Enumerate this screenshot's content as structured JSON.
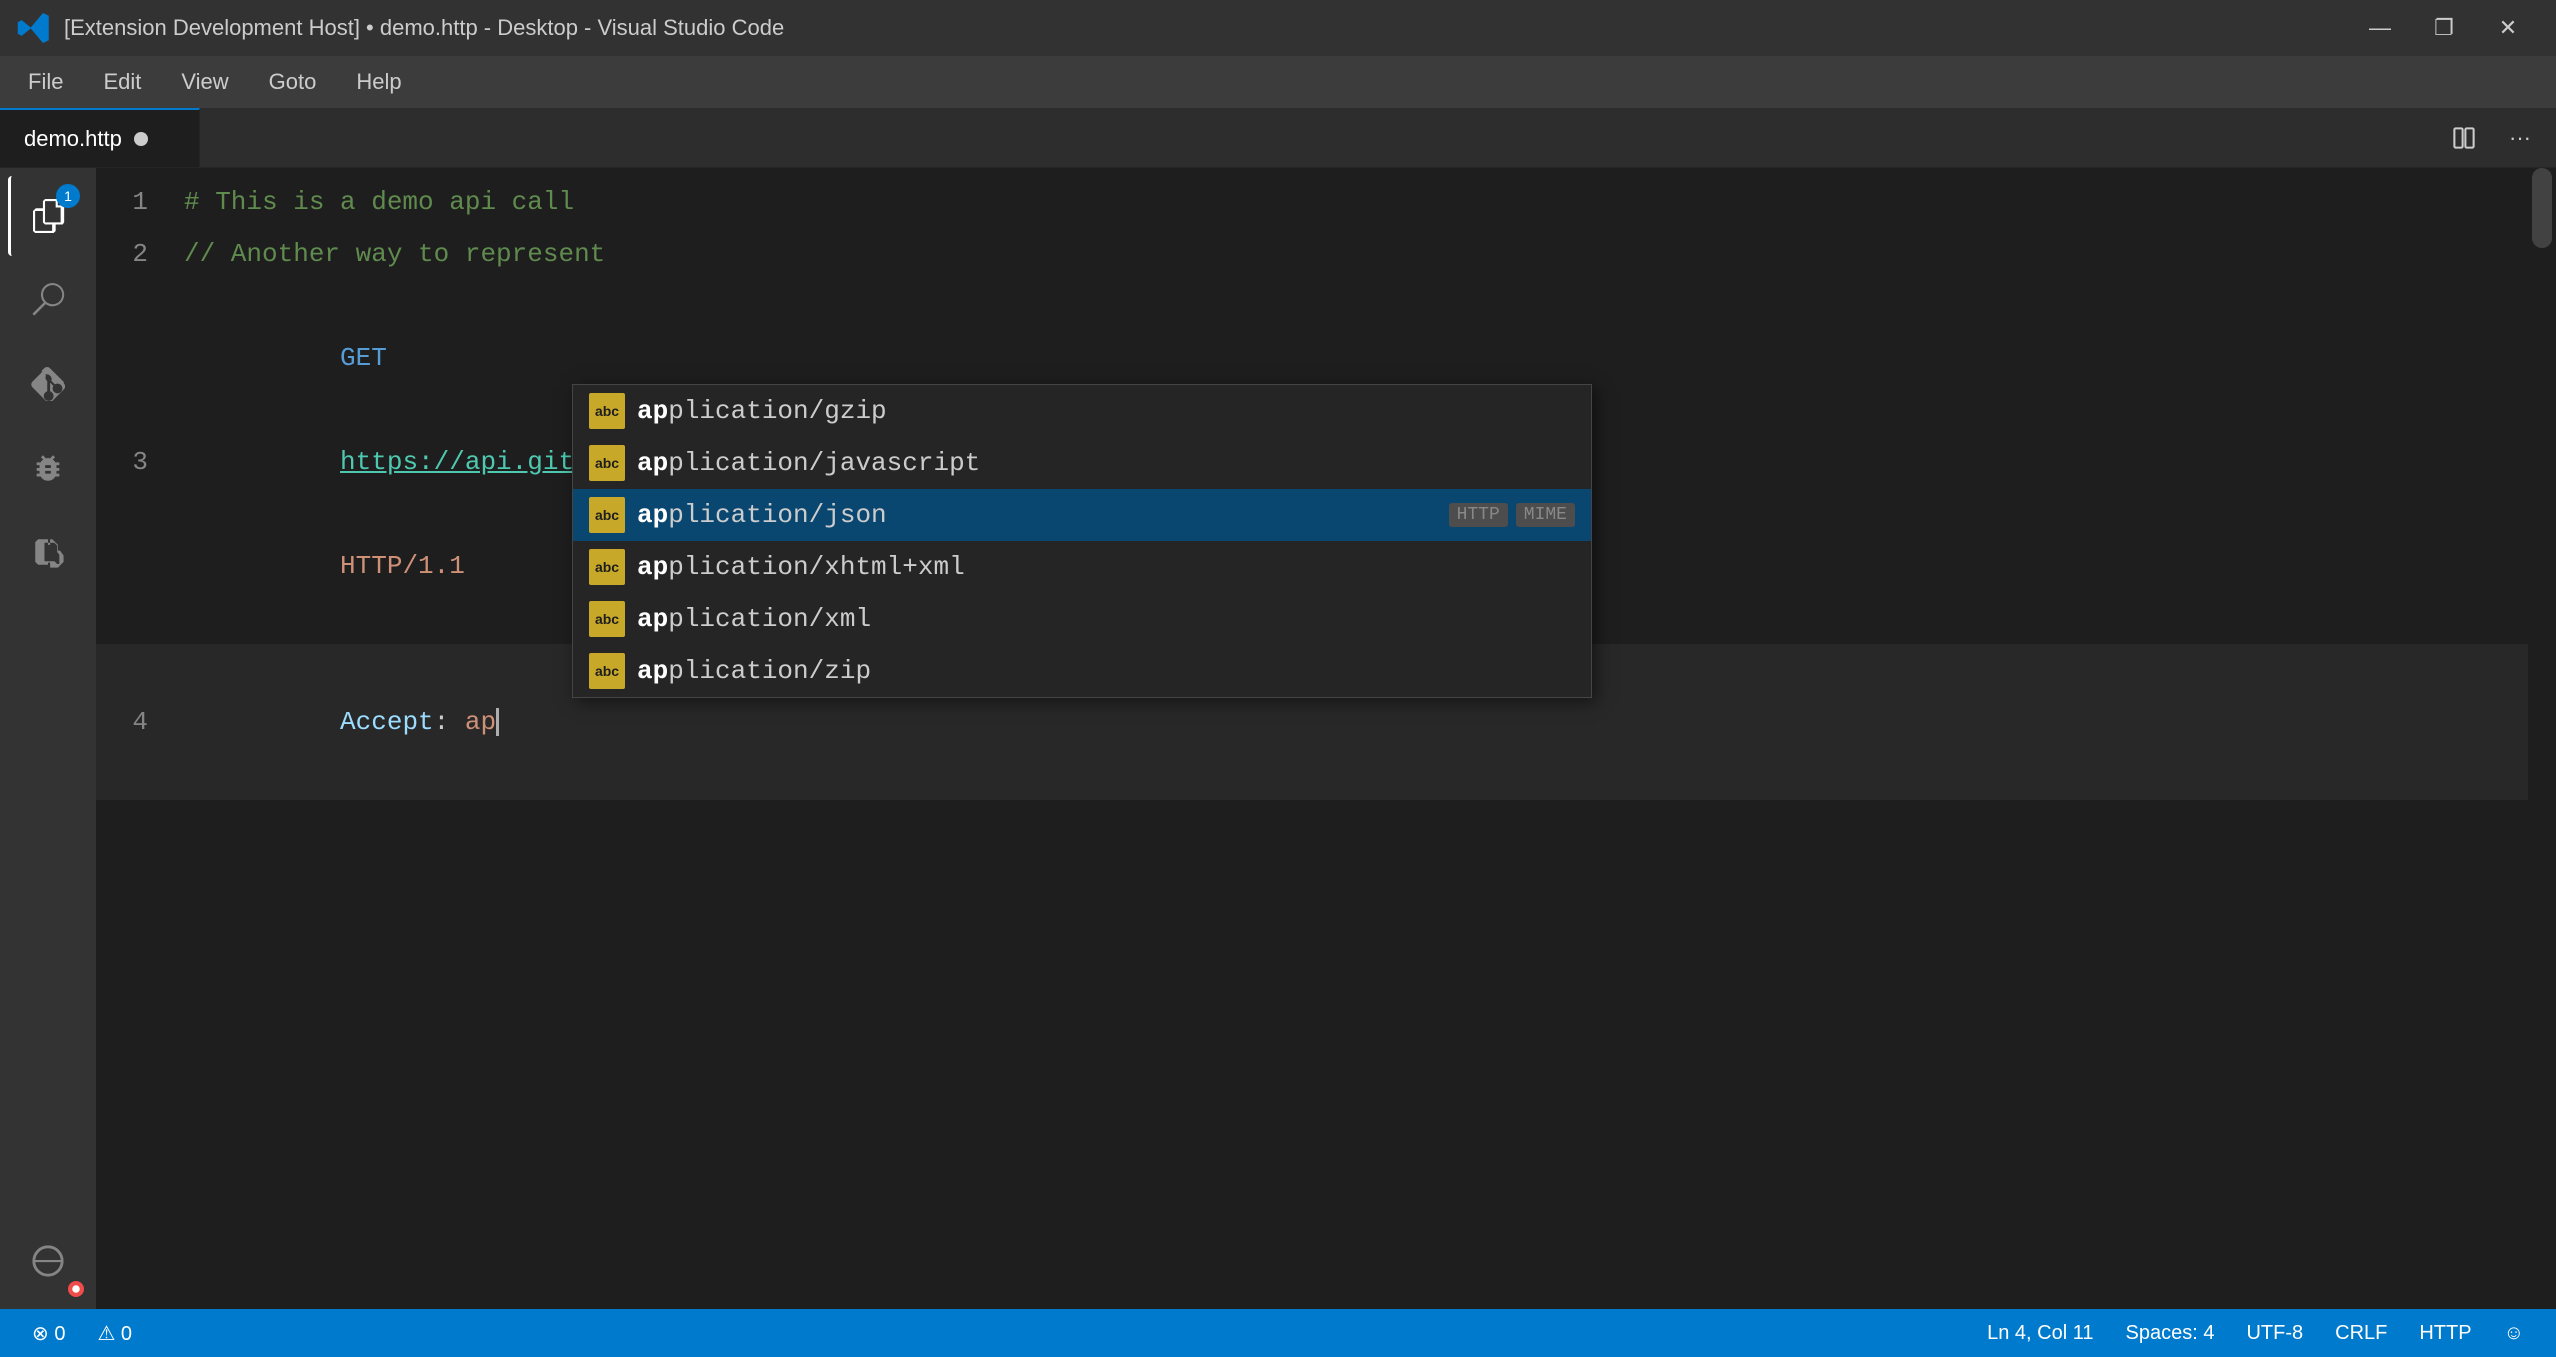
{
  "titlebar": {
    "title": "[Extension Development Host] • demo.http - Desktop - Visual Studio Code",
    "icon": "VSCode",
    "minimize": "—",
    "maximize": "❐",
    "close": "✕"
  },
  "menubar": {
    "items": [
      "File",
      "Edit",
      "View",
      "Goto",
      "Help"
    ]
  },
  "tabs": {
    "active": "demo.http",
    "items": [
      {
        "name": "demo.http",
        "modified": true
      }
    ]
  },
  "activity_bar": {
    "items": [
      {
        "id": "explorer",
        "icon": "files",
        "badge": "1",
        "active": true
      },
      {
        "id": "search",
        "icon": "search",
        "badge": null
      },
      {
        "id": "git",
        "icon": "git",
        "badge": null
      },
      {
        "id": "debug",
        "icon": "debug",
        "badge": null
      },
      {
        "id": "extensions",
        "icon": "blocks",
        "badge": null
      },
      {
        "id": "remote",
        "icon": "remote",
        "badge": null
      }
    ]
  },
  "editor": {
    "lines": [
      {
        "number": "1",
        "text": "# This is a demo api call",
        "type": "comment"
      },
      {
        "number": "2",
        "text": "// Another way to represent",
        "type": "comment"
      },
      {
        "number": "3",
        "text": "GET https://api.github.com/users/Huachao HTTP/1.1",
        "type": "request"
      },
      {
        "number": "4",
        "text": "Accept: ap",
        "type": "header",
        "active": true
      }
    ]
  },
  "autocomplete": {
    "items": [
      {
        "icon": "abc",
        "text": "application/gzip",
        "match": "ap",
        "badges": []
      },
      {
        "icon": "abc",
        "text": "application/javascript",
        "match": "ap",
        "badges": []
      },
      {
        "icon": "abc",
        "text": "application/json",
        "match": "ap",
        "badges": [
          "HTTP",
          "MIME"
        ],
        "selected": true
      },
      {
        "icon": "abc",
        "text": "application/xhtml+xml",
        "match": "ap",
        "badges": []
      },
      {
        "icon": "abc",
        "text": "application/xml",
        "match": "ap",
        "badges": []
      },
      {
        "icon": "abc",
        "text": "application/zip",
        "match": "ap",
        "badges": []
      }
    ]
  },
  "statusbar": {
    "left_items": [
      {
        "id": "errors",
        "text": "⊗ 0"
      },
      {
        "id": "warnings",
        "text": "⚠ 0"
      }
    ],
    "right_items": [
      {
        "id": "position",
        "text": "Ln 4, Col 11"
      },
      {
        "id": "spaces",
        "text": "Spaces: 4"
      },
      {
        "id": "encoding",
        "text": "UTF-8"
      },
      {
        "id": "line-ending",
        "text": "CRLF"
      },
      {
        "id": "language",
        "text": "HTTP"
      },
      {
        "id": "smiley",
        "text": "☺"
      }
    ]
  }
}
